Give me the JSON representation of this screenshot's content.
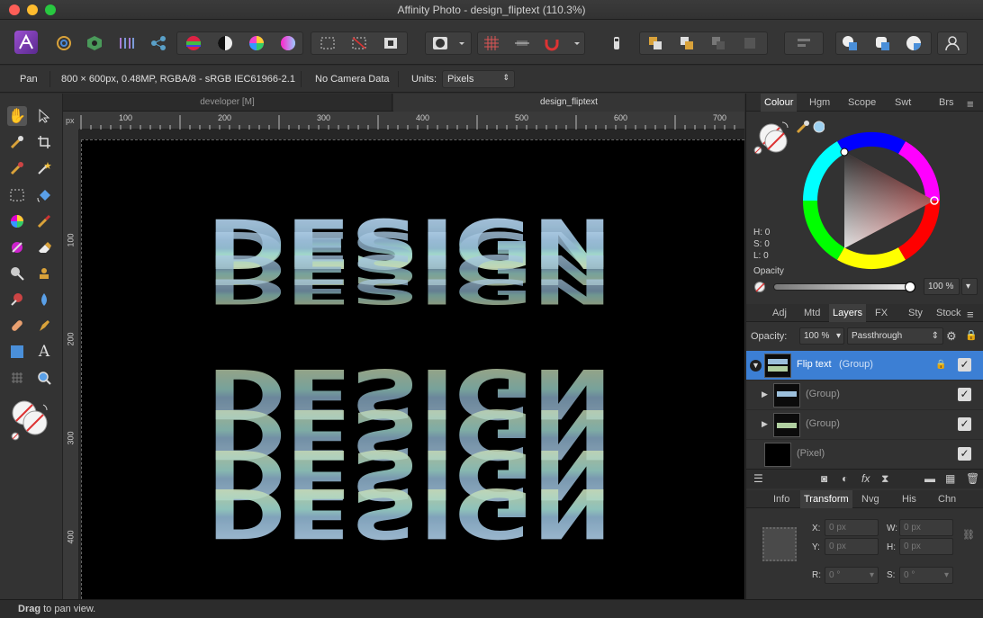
{
  "window": {
    "title": "Affinity Photo - design_fliptext (110.3%)"
  },
  "context": {
    "tool": "Pan",
    "doc_info": "800 × 600px, 0.48MP, RGBA/8 - sRGB IEC61966-2.1",
    "camera": "No Camera Data",
    "units_label": "Units:",
    "units_value": "Pixels"
  },
  "doc_tabs": [
    "developer [M]",
    "design_fliptext"
  ],
  "ruler": {
    "unit": "px",
    "top_ticks": [
      "100",
      "200",
      "300",
      "400",
      "500",
      "600",
      "700"
    ],
    "left_ticks": [
      "100",
      "200",
      "300",
      "400"
    ]
  },
  "canvas": {
    "text": "DESIGN"
  },
  "status": {
    "bold": "Drag",
    "rest": " to pan view."
  },
  "colour_panel": {
    "tabs": [
      "Colour",
      "Hgm",
      "Scope",
      "Swt",
      "Brs"
    ],
    "h": "H: 0",
    "s": "S: 0",
    "l": "L: 0",
    "opacity_label": "Opacity",
    "opacity_value": "100 %"
  },
  "layers_panel": {
    "tabs": [
      "Adj",
      "Mtd",
      "Layers",
      "FX",
      "Sty",
      "Stock"
    ],
    "opacity_label": "Opacity:",
    "opacity_value": "100 %",
    "blend_mode": "Passthrough",
    "layers": [
      {
        "name": "Flip text",
        "type": "(Group)"
      },
      {
        "name": "",
        "type": "(Group)"
      },
      {
        "name": "",
        "type": "(Group)"
      },
      {
        "name": "",
        "type": "(Pixel)"
      }
    ]
  },
  "transform_panel": {
    "tabs": [
      "Info",
      "Transform",
      "Nvg",
      "His",
      "Chn"
    ],
    "x_label": "X:",
    "y_label": "Y:",
    "w_label": "W:",
    "h_label": "H:",
    "r_label": "R:",
    "s_label": "S:",
    "x": "0 px",
    "y": "0 px",
    "w": "0 px",
    "h": "0 px",
    "r": "0 °",
    "s": "0 °"
  },
  "colors": {
    "accent": "#4a8fd9",
    "selected_layer": "#3c7fd4"
  }
}
